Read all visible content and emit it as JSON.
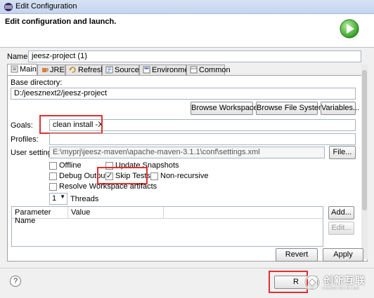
{
  "window": {
    "title": "Edit Configuration"
  },
  "header": {
    "heading": "Edit configuration and launch."
  },
  "name": {
    "label": "Name:",
    "value": "jeesz-project (1)"
  },
  "tabs": [
    {
      "label": "Main",
      "icon": "main-tab-icon"
    },
    {
      "label": "JRE",
      "icon": "jre-icon"
    },
    {
      "label": "Refresh",
      "icon": "refresh-icon"
    },
    {
      "label": "Source",
      "icon": "source-icon"
    },
    {
      "label": "Environment",
      "icon": "environment-icon"
    },
    {
      "label": "Common",
      "icon": "common-icon"
    }
  ],
  "main": {
    "base_dir_label": "Base directory:",
    "base_dir_value": "D:/jeesznext2/jeesz-project",
    "browse_workspace": "Browse Workspace...",
    "browse_fs": "Browse File System...",
    "variables": "Variables...",
    "goals_label": "Goals:",
    "goals_value": "clean install -X",
    "profiles_label": "Profiles:",
    "profiles_value": "",
    "user_settings_label": "User settings:",
    "user_settings_value": "E:\\myprj\\jeesz-maven\\apache-maven-3.1.1\\conf\\settings.xml",
    "file_button": "File...",
    "offline": "Offline",
    "update_snapshots": "Update Snapshots",
    "debug_output": "Debug Output",
    "skip_tests": "Skip Tests",
    "non_recursive": "Non-recursive",
    "resolve_artifacts": "Resolve Workspace artifacts",
    "threads_value": "1",
    "threads_label": "Threads",
    "param_col": "Parameter Name",
    "value_col": "Value",
    "add_button": "Add...",
    "edit_button": "Edit..."
  },
  "actions": {
    "revert": "Revert",
    "apply": "Apply",
    "run": "R"
  },
  "watermark": {
    "text": "创新互联",
    "sub": "CHUANG XIN HU LIAN"
  }
}
